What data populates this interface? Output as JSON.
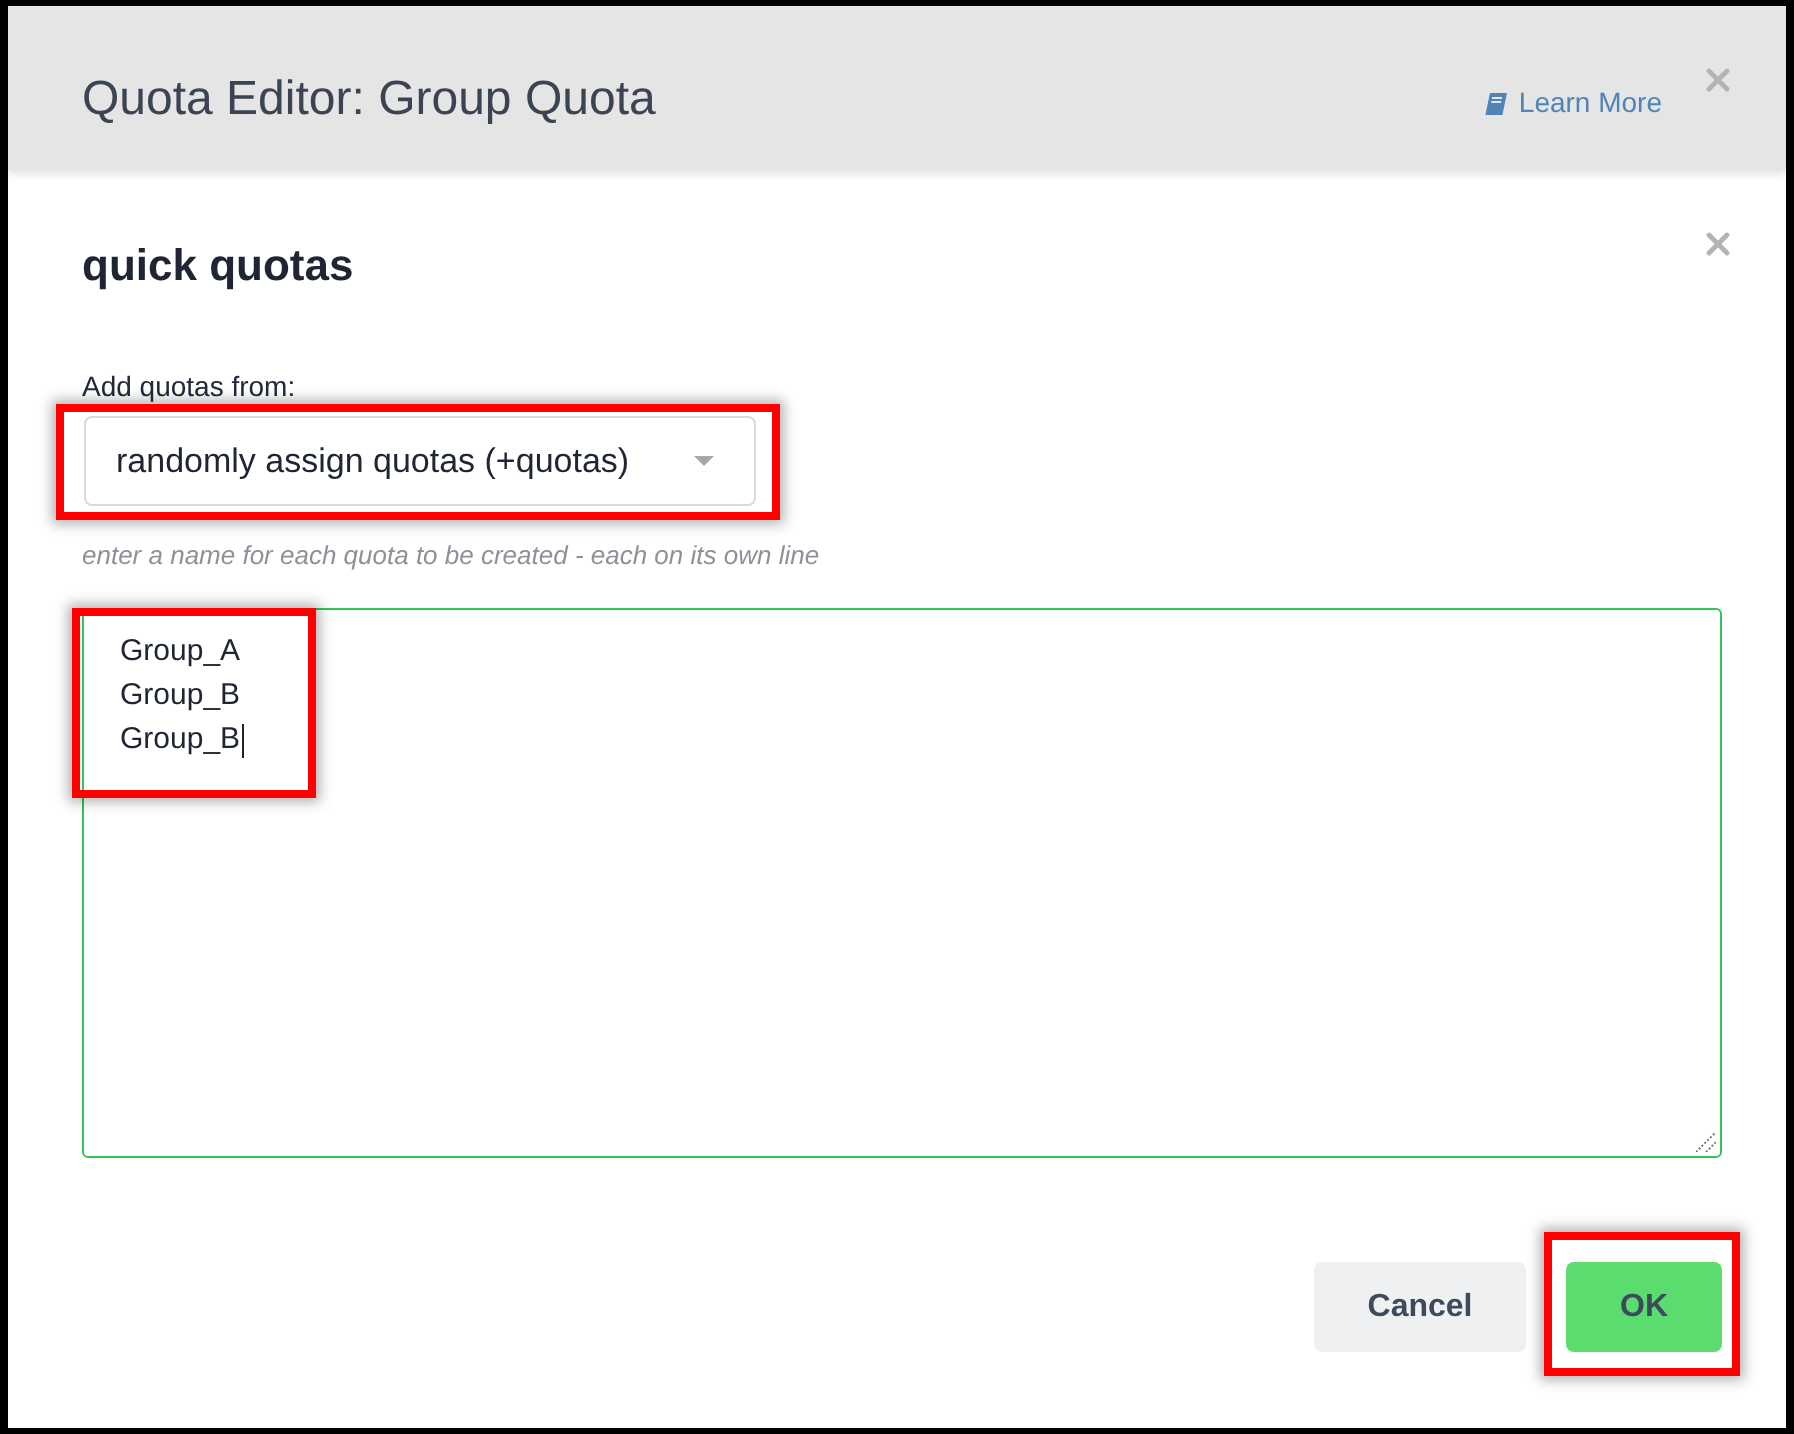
{
  "header": {
    "title": "Quota Editor: Group Quota",
    "link": "Learn More"
  },
  "panel": {
    "title": "quick quotas"
  },
  "source": {
    "label": "Add quotas from:",
    "value": "randomly assign quotas (+quotas)",
    "highlighted": true
  },
  "names": {
    "hint": "enter a name for each quota to be created - each on its own line",
    "lines": [
      "Group_A",
      "Group_B",
      "Group_B"
    ],
    "focused": true,
    "highlighted": true
  },
  "buttons": [
    {
      "label": "Cancel",
      "kind": "secondary",
      "highlighted": false
    },
    {
      "label": "OK",
      "kind": "primary",
      "highlighted": true
    }
  ]
}
